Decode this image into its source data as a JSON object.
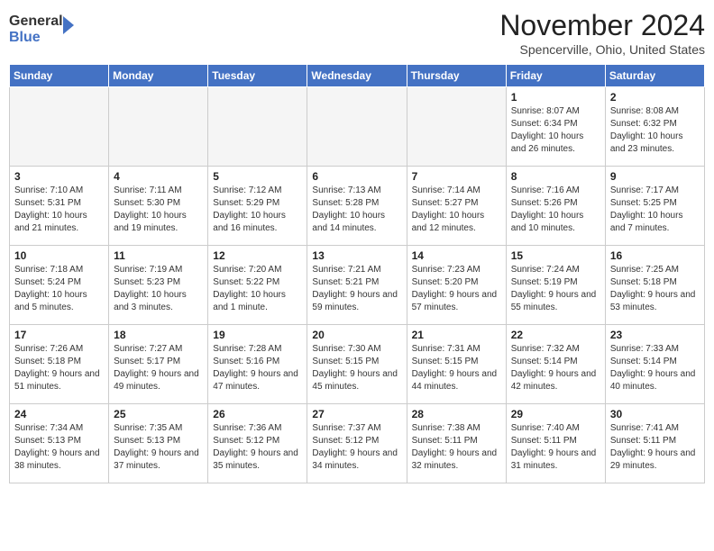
{
  "header": {
    "logo_line1": "General",
    "logo_line2": "Blue",
    "month": "November 2024",
    "location": "Spencerville, Ohio, United States"
  },
  "weekdays": [
    "Sunday",
    "Monday",
    "Tuesday",
    "Wednesday",
    "Thursday",
    "Friday",
    "Saturday"
  ],
  "weeks": [
    [
      {
        "day": "",
        "info": ""
      },
      {
        "day": "",
        "info": ""
      },
      {
        "day": "",
        "info": ""
      },
      {
        "day": "",
        "info": ""
      },
      {
        "day": "",
        "info": ""
      },
      {
        "day": "1",
        "info": "Sunrise: 8:07 AM\nSunset: 6:34 PM\nDaylight: 10 hours and 26 minutes."
      },
      {
        "day": "2",
        "info": "Sunrise: 8:08 AM\nSunset: 6:32 PM\nDaylight: 10 hours and 23 minutes."
      }
    ],
    [
      {
        "day": "3",
        "info": "Sunrise: 7:10 AM\nSunset: 5:31 PM\nDaylight: 10 hours and 21 minutes."
      },
      {
        "day": "4",
        "info": "Sunrise: 7:11 AM\nSunset: 5:30 PM\nDaylight: 10 hours and 19 minutes."
      },
      {
        "day": "5",
        "info": "Sunrise: 7:12 AM\nSunset: 5:29 PM\nDaylight: 10 hours and 16 minutes."
      },
      {
        "day": "6",
        "info": "Sunrise: 7:13 AM\nSunset: 5:28 PM\nDaylight: 10 hours and 14 minutes."
      },
      {
        "day": "7",
        "info": "Sunrise: 7:14 AM\nSunset: 5:27 PM\nDaylight: 10 hours and 12 minutes."
      },
      {
        "day": "8",
        "info": "Sunrise: 7:16 AM\nSunset: 5:26 PM\nDaylight: 10 hours and 10 minutes."
      },
      {
        "day": "9",
        "info": "Sunrise: 7:17 AM\nSunset: 5:25 PM\nDaylight: 10 hours and 7 minutes."
      }
    ],
    [
      {
        "day": "10",
        "info": "Sunrise: 7:18 AM\nSunset: 5:24 PM\nDaylight: 10 hours and 5 minutes."
      },
      {
        "day": "11",
        "info": "Sunrise: 7:19 AM\nSunset: 5:23 PM\nDaylight: 10 hours and 3 minutes."
      },
      {
        "day": "12",
        "info": "Sunrise: 7:20 AM\nSunset: 5:22 PM\nDaylight: 10 hours and 1 minute."
      },
      {
        "day": "13",
        "info": "Sunrise: 7:21 AM\nSunset: 5:21 PM\nDaylight: 9 hours and 59 minutes."
      },
      {
        "day": "14",
        "info": "Sunrise: 7:23 AM\nSunset: 5:20 PM\nDaylight: 9 hours and 57 minutes."
      },
      {
        "day": "15",
        "info": "Sunrise: 7:24 AM\nSunset: 5:19 PM\nDaylight: 9 hours and 55 minutes."
      },
      {
        "day": "16",
        "info": "Sunrise: 7:25 AM\nSunset: 5:18 PM\nDaylight: 9 hours and 53 minutes."
      }
    ],
    [
      {
        "day": "17",
        "info": "Sunrise: 7:26 AM\nSunset: 5:18 PM\nDaylight: 9 hours and 51 minutes."
      },
      {
        "day": "18",
        "info": "Sunrise: 7:27 AM\nSunset: 5:17 PM\nDaylight: 9 hours and 49 minutes."
      },
      {
        "day": "19",
        "info": "Sunrise: 7:28 AM\nSunset: 5:16 PM\nDaylight: 9 hours and 47 minutes."
      },
      {
        "day": "20",
        "info": "Sunrise: 7:30 AM\nSunset: 5:15 PM\nDaylight: 9 hours and 45 minutes."
      },
      {
        "day": "21",
        "info": "Sunrise: 7:31 AM\nSunset: 5:15 PM\nDaylight: 9 hours and 44 minutes."
      },
      {
        "day": "22",
        "info": "Sunrise: 7:32 AM\nSunset: 5:14 PM\nDaylight: 9 hours and 42 minutes."
      },
      {
        "day": "23",
        "info": "Sunrise: 7:33 AM\nSunset: 5:14 PM\nDaylight: 9 hours and 40 minutes."
      }
    ],
    [
      {
        "day": "24",
        "info": "Sunrise: 7:34 AM\nSunset: 5:13 PM\nDaylight: 9 hours and 38 minutes."
      },
      {
        "day": "25",
        "info": "Sunrise: 7:35 AM\nSunset: 5:13 PM\nDaylight: 9 hours and 37 minutes."
      },
      {
        "day": "26",
        "info": "Sunrise: 7:36 AM\nSunset: 5:12 PM\nDaylight: 9 hours and 35 minutes."
      },
      {
        "day": "27",
        "info": "Sunrise: 7:37 AM\nSunset: 5:12 PM\nDaylight: 9 hours and 34 minutes."
      },
      {
        "day": "28",
        "info": "Sunrise: 7:38 AM\nSunset: 5:11 PM\nDaylight: 9 hours and 32 minutes."
      },
      {
        "day": "29",
        "info": "Sunrise: 7:40 AM\nSunset: 5:11 PM\nDaylight: 9 hours and 31 minutes."
      },
      {
        "day": "30",
        "info": "Sunrise: 7:41 AM\nSunset: 5:11 PM\nDaylight: 9 hours and 29 minutes."
      }
    ]
  ]
}
